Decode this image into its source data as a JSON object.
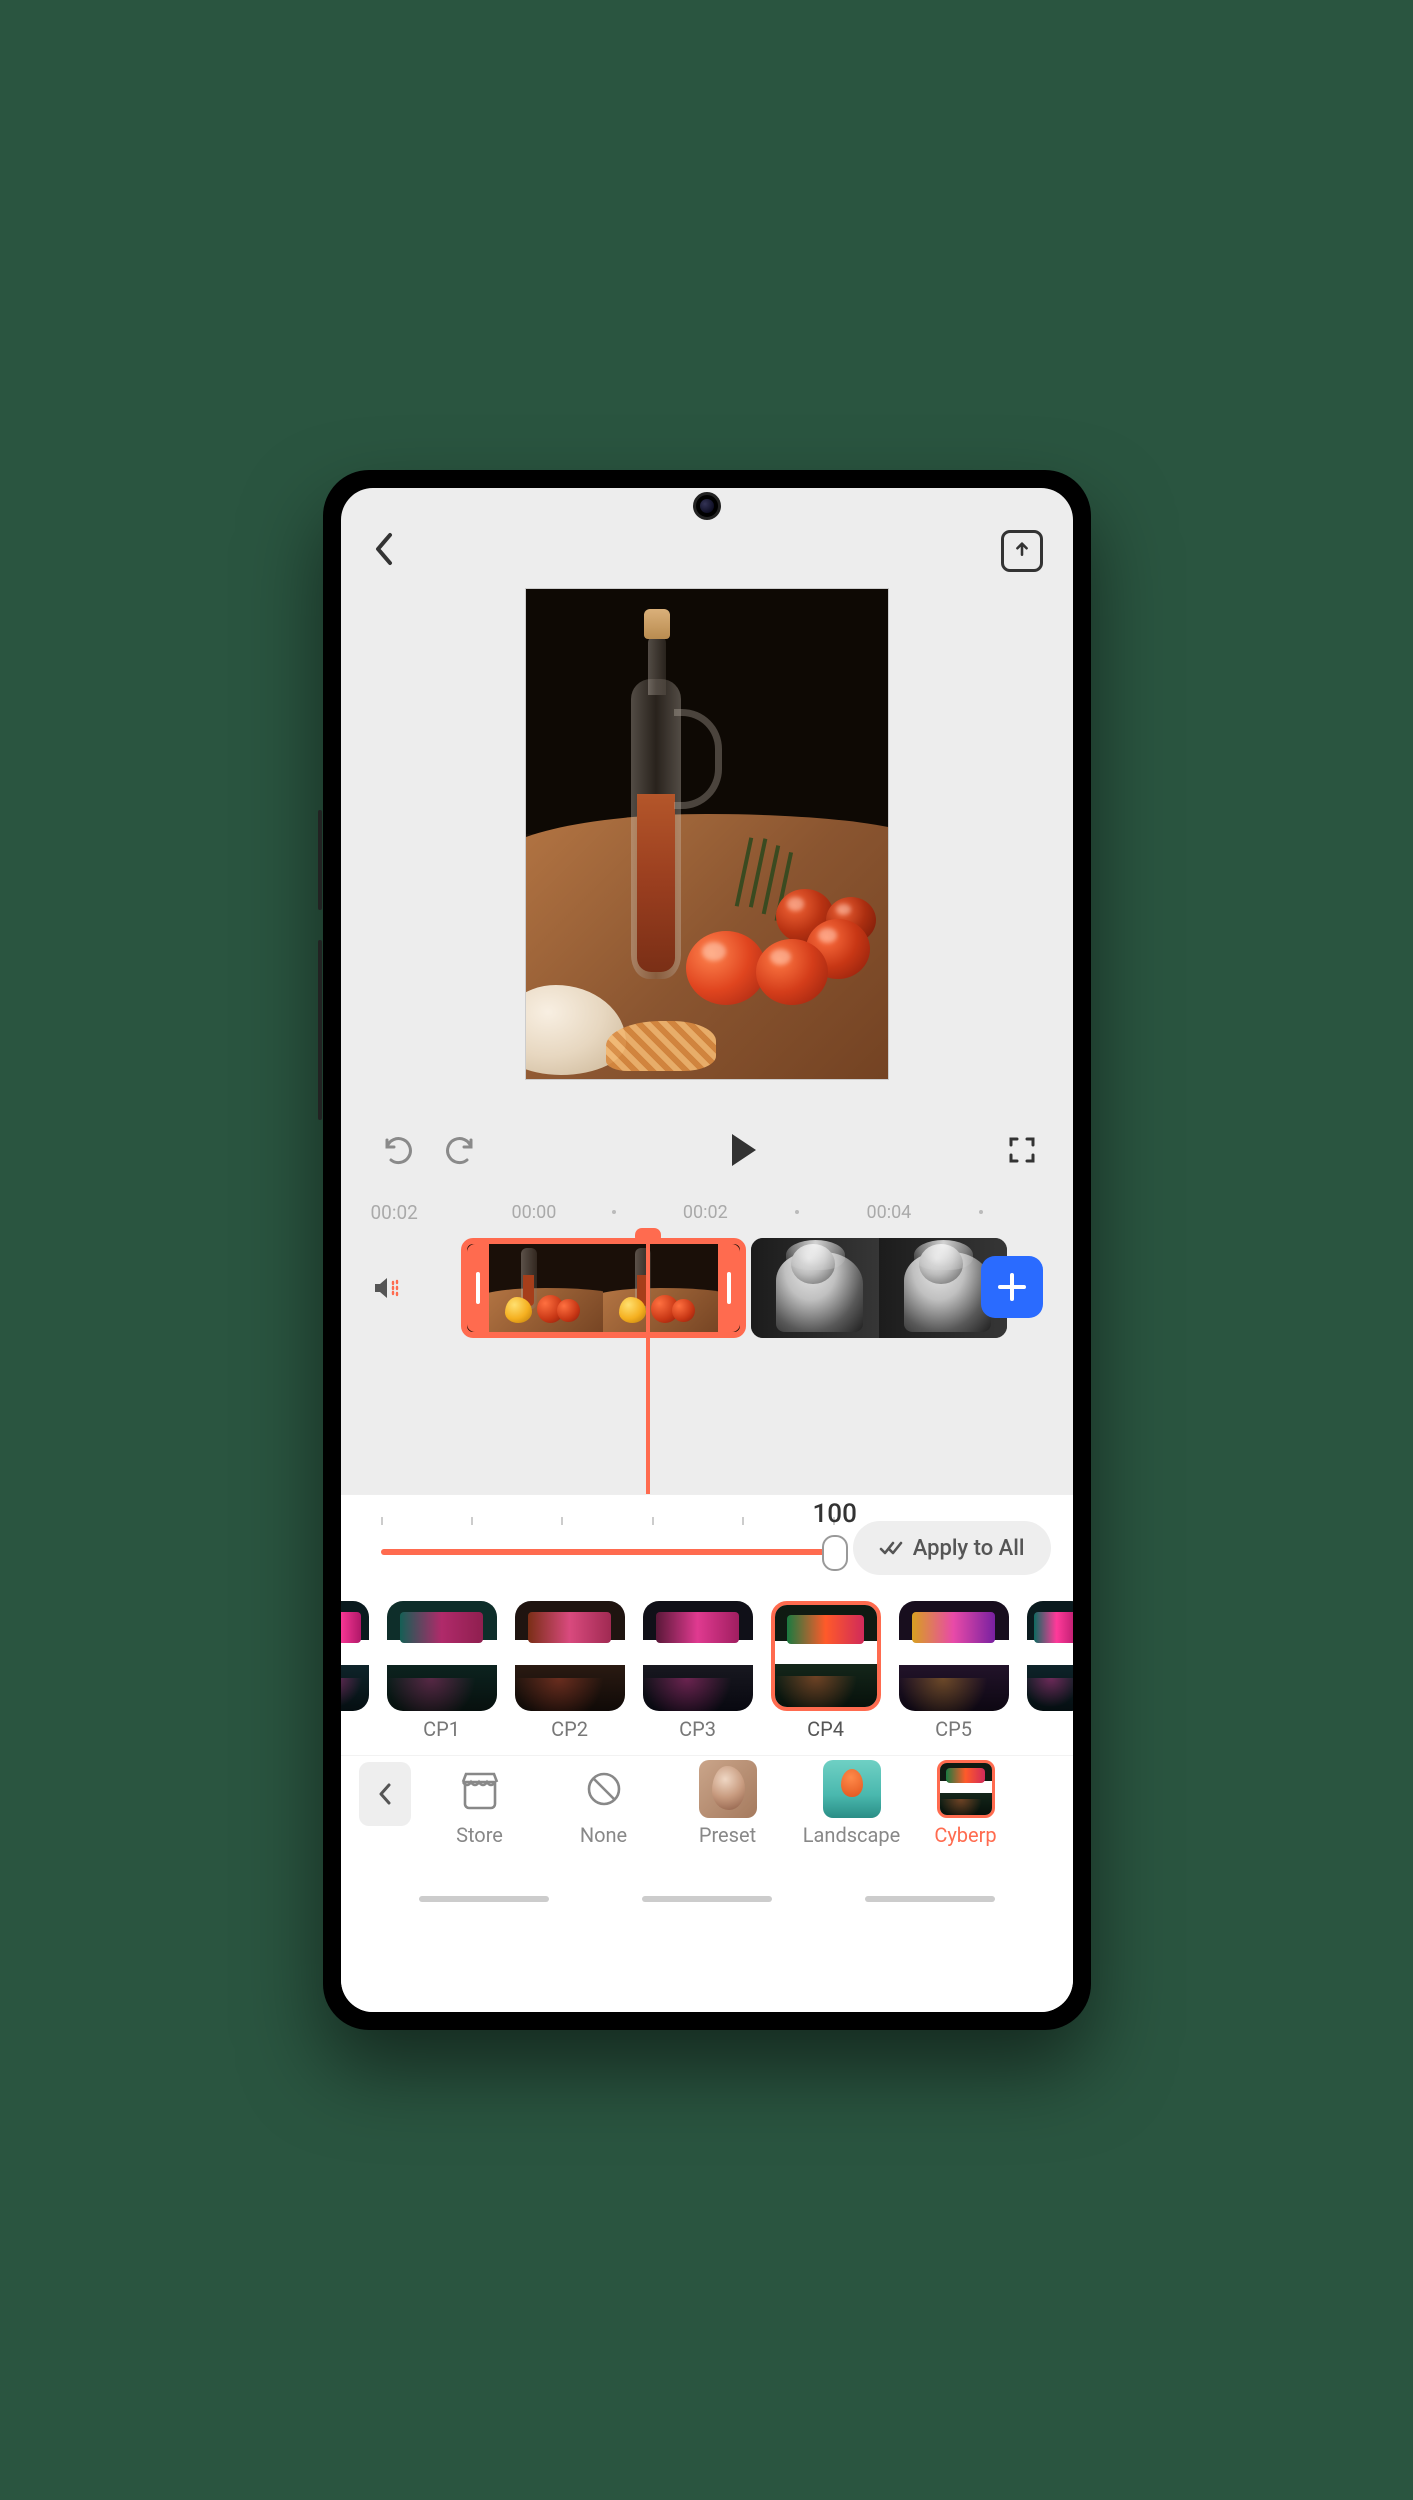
{
  "header": {},
  "controls": {},
  "timeline": {
    "current_time": "00:02",
    "marks": [
      "00:00",
      "00:02",
      "00:04"
    ]
  },
  "slider": {
    "value": 100,
    "min": 0,
    "max": 100
  },
  "apply_all_label": "Apply to All",
  "filters": [
    {
      "id": "CP1",
      "label": "CP1",
      "selected": false
    },
    {
      "id": "CP2",
      "label": "CP2",
      "selected": false
    },
    {
      "id": "CP3",
      "label": "CP3",
      "selected": false
    },
    {
      "id": "CP4",
      "label": "CP4",
      "selected": true
    },
    {
      "id": "CP5",
      "label": "CP5",
      "selected": false
    }
  ],
  "categories": [
    {
      "id": "store",
      "label": "Store",
      "type": "icon"
    },
    {
      "id": "none",
      "label": "None",
      "type": "icon"
    },
    {
      "id": "preset",
      "label": "Preset",
      "type": "thumb"
    },
    {
      "id": "landscape",
      "label": "Landscape",
      "type": "thumb"
    },
    {
      "id": "cyberpunk",
      "label": "Cyberp",
      "type": "thumb",
      "selected": true
    }
  ],
  "accent": "#ff6b4f"
}
